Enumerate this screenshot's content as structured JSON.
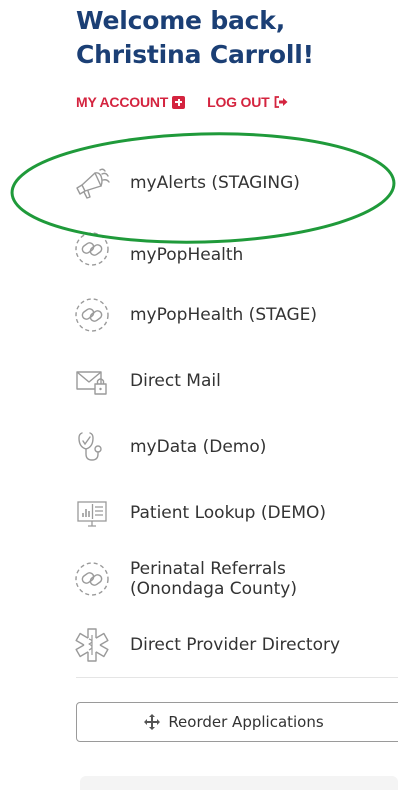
{
  "header": {
    "welcome_line1": "Welcome back,",
    "welcome_line2": "Christina Carroll!"
  },
  "account_links": {
    "my_account": "MY ACCOUNT",
    "log_out": "LOG OUT"
  },
  "apps": [
    {
      "label": "myAlerts (STAGING)",
      "icon": "megaphone-icon"
    },
    {
      "label": "myPopHealth",
      "icon": "chain-link-icon"
    },
    {
      "label": "myPopHealth (STAGE)",
      "icon": "chain-link-icon"
    },
    {
      "label": "Direct Mail",
      "icon": "secure-mail-icon"
    },
    {
      "label": "myData (Demo)",
      "icon": "stethoscope-icon"
    },
    {
      "label": "Patient Lookup (DEMO)",
      "icon": "dashboard-monitor-icon"
    },
    {
      "label": "Perinatal Referrals (Onondaga County)",
      "icon": "chain-link-icon"
    },
    {
      "label": "Direct Provider Directory",
      "icon": "star-of-life-icon"
    }
  ],
  "reorder_button": {
    "label": "Reorder Applications",
    "icon": "move-arrows-icon"
  },
  "colors": {
    "heading": "#1b3f75",
    "link": "#d4243f",
    "annotation": "#1f9a3a",
    "text": "#333333"
  }
}
